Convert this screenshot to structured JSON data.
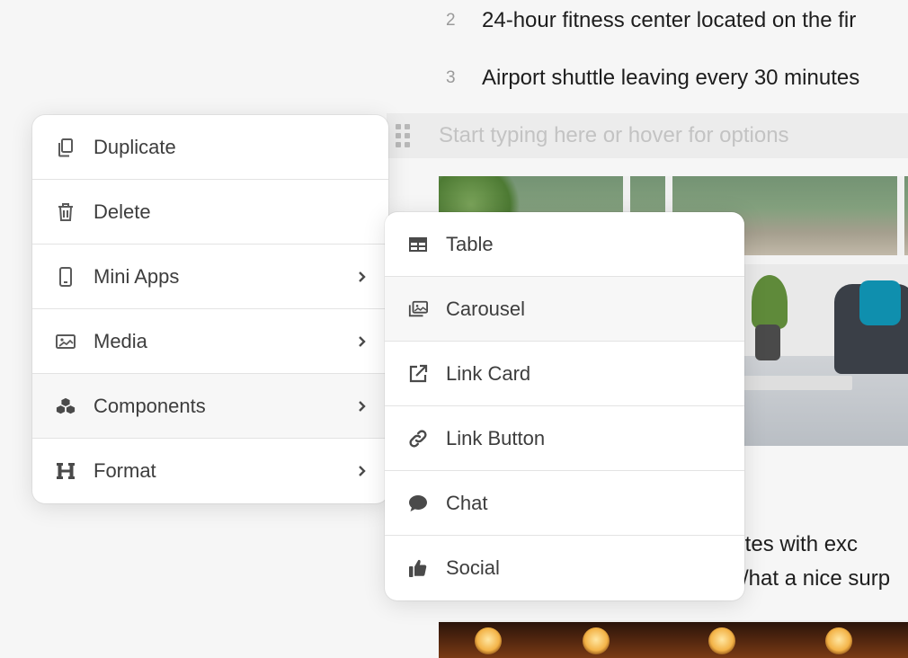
{
  "editor": {
    "list_items": [
      {
        "number": "2",
        "text": "24-hour fitness center located on the fir"
      },
      {
        "number": "3",
        "text": "Airport shuttle leaving every 30 minutes"
      }
    ],
    "placeholder": "Start typing here or hover for options",
    "body_lines": [
      "vorites with exc",
      "/hat a nice surp"
    ]
  },
  "context_menu": {
    "items": [
      {
        "label": "Duplicate",
        "icon": "duplicate-icon"
      },
      {
        "label": "Delete",
        "icon": "trash-icon"
      },
      {
        "label": "Mini Apps",
        "icon": "mobile-icon",
        "submenu": true
      },
      {
        "label": "Media",
        "icon": "image-icon",
        "submenu": true
      },
      {
        "label": "Components",
        "icon": "cubes-icon",
        "submenu": true,
        "highlighted": true
      },
      {
        "label": "Format",
        "icon": "heading-icon",
        "submenu": true
      }
    ]
  },
  "components_submenu": {
    "items": [
      {
        "label": "Table",
        "icon": "table-icon"
      },
      {
        "label": "Carousel",
        "icon": "carousel-icon",
        "highlighted": true
      },
      {
        "label": "Link Card",
        "icon": "external-link-icon"
      },
      {
        "label": "Link Button",
        "icon": "link-icon"
      },
      {
        "label": "Chat",
        "icon": "chat-bubble-icon"
      },
      {
        "label": "Social",
        "icon": "thumbs-up-icon"
      }
    ]
  },
  "colors": {
    "background": "#f6f6f6",
    "menu_bg": "#ffffff",
    "highlight_bg": "#f7f7f7",
    "icon": "#5a5a5a",
    "text": "#3d3d3d"
  }
}
